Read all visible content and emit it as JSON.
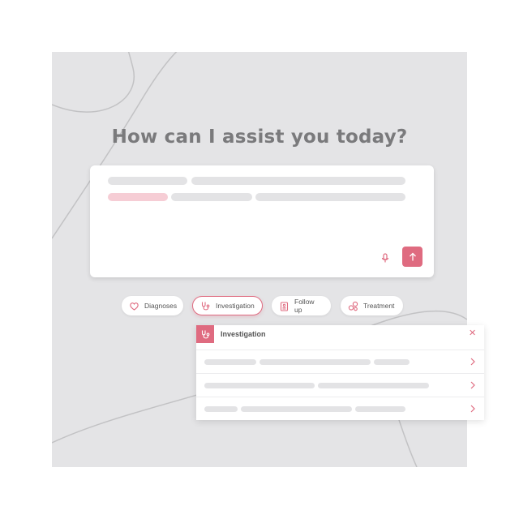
{
  "prompt": {
    "title": "How can I assist you today?"
  },
  "colors": {
    "accent": "#df6b80",
    "panel_bg": "#e4e4e6",
    "skeleton": "#e3e3e5",
    "skeleton_highlight": "#f6cdd5"
  },
  "chips": [
    {
      "label": "Diagnoses",
      "icon": "heart-icon",
      "active": false
    },
    {
      "label": "Investigation",
      "icon": "stethoscope-icon",
      "active": true
    },
    {
      "label": "Follow up",
      "icon": "clipboard-icon",
      "active": false
    },
    {
      "label": "Treatment",
      "icon": "pills-icon",
      "active": false
    }
  ],
  "dropdown": {
    "title": "Investigation",
    "icon": "stethoscope-icon",
    "close_icon": "close-icon",
    "rows": 3
  },
  "input_actions": {
    "mic_icon": "microphone-icon",
    "send_icon": "arrow-up-icon"
  }
}
